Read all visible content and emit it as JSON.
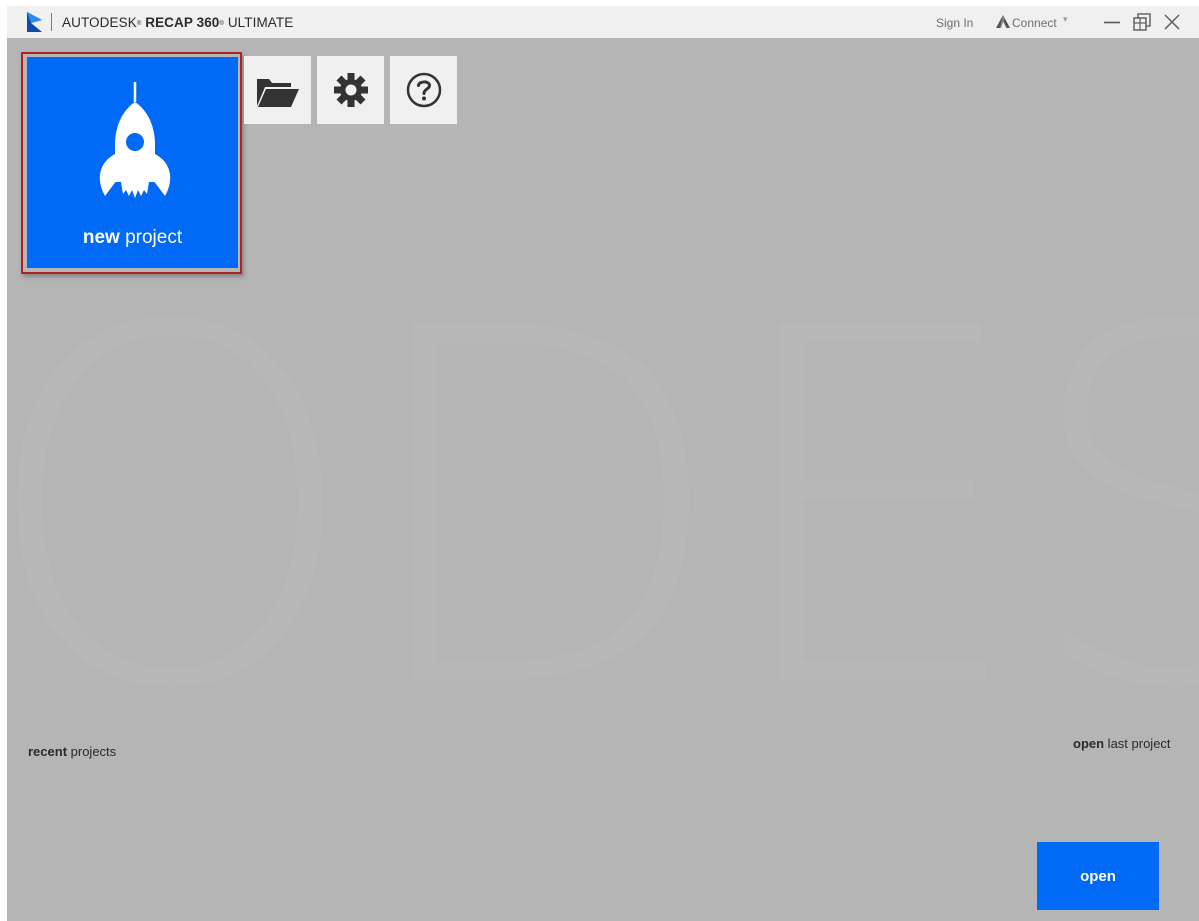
{
  "app": {
    "brand": "AUTODESK",
    "product": "RECAP 360",
    "edition": "ULTIMATE",
    "registered_mark": "®"
  },
  "header": {
    "sign_in": "Sign In",
    "connect": "Connect",
    "connect_caret": "▾"
  },
  "window_controls": [
    "minimize-icon",
    "restore-icon",
    "close-icon"
  ],
  "watermark_text": "ODESK",
  "new_project": {
    "bold": "new",
    "rest": " project",
    "icon": "rocket-icon"
  },
  "toolbar": [
    {
      "name": "open-folder",
      "icon": "folder-open-icon"
    },
    {
      "name": "settings",
      "icon": "gear-icon"
    },
    {
      "name": "help",
      "icon": "help-icon"
    }
  ],
  "recent": {
    "bold": "recent",
    "rest": " projects"
  },
  "open_last": {
    "bold": "open",
    "rest": " last project"
  },
  "open_button": "open",
  "colors": {
    "accent": "#0069f5",
    "background": "#b5b5b5",
    "titlebar": "#f0f0f0",
    "focus_border": "#b12222"
  }
}
